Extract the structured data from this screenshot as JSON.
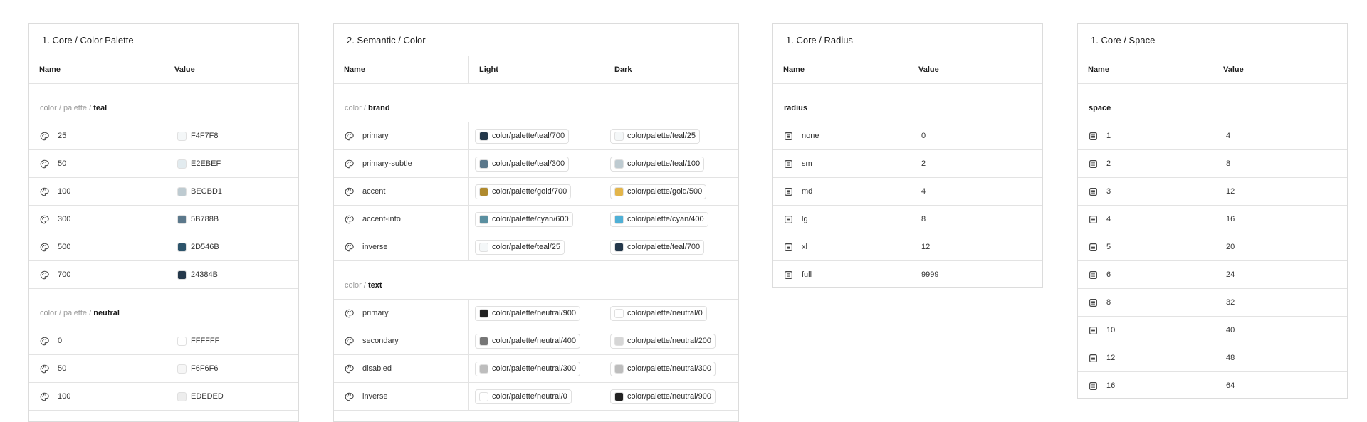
{
  "palette_panel": {
    "title": "1. Core / Color Palette",
    "headers": [
      "Name",
      "Value"
    ],
    "groups": [
      {
        "prefix": "color / palette / ",
        "name": "teal",
        "rows": [
          {
            "name": "25",
            "value": "F4F7F8",
            "color": "#F4F7F8"
          },
          {
            "name": "50",
            "value": "E2EBEF",
            "color": "#E2EBEF"
          },
          {
            "name": "100",
            "value": "BECBD1",
            "color": "#BECBD1"
          },
          {
            "name": "300",
            "value": "5B788B",
            "color": "#5B788B"
          },
          {
            "name": "500",
            "value": "2D546B",
            "color": "#2D546B"
          },
          {
            "name": "700",
            "value": "24384B",
            "color": "#24384B"
          }
        ]
      },
      {
        "prefix": "color / palette / ",
        "name": "neutral",
        "rows": [
          {
            "name": "0",
            "value": "FFFFFF",
            "color": "#FFFFFF"
          },
          {
            "name": "50",
            "value": "F6F6F6",
            "color": "#F6F6F6"
          },
          {
            "name": "100",
            "value": "EDEDED",
            "color": "#EDEDED"
          }
        ]
      }
    ]
  },
  "semantic_panel": {
    "title": "2. Semantic / Color",
    "headers": [
      "Name",
      "Light",
      "Dark"
    ],
    "groups": [
      {
        "prefix": "color / ",
        "name": "brand",
        "rows": [
          {
            "name": "primary",
            "light": "color/palette/teal/700",
            "light_color": "#24384B",
            "dark": "color/palette/teal/25",
            "dark_color": "#F4F7F8"
          },
          {
            "name": "primary-subtle",
            "light": "color/palette/teal/300",
            "light_color": "#5B788B",
            "dark": "color/palette/teal/100",
            "dark_color": "#BECBD1"
          },
          {
            "name": "accent",
            "light": "color/palette/gold/700",
            "light_color": "#B08A2E",
            "dark": "color/palette/gold/500",
            "dark_color": "#E3B54A"
          },
          {
            "name": "accent-info",
            "light": "color/palette/cyan/600",
            "light_color": "#5A8FA0",
            "dark": "color/palette/cyan/400",
            "dark_color": "#4FB0D6"
          },
          {
            "name": "inverse",
            "light": "color/palette/teal/25",
            "light_color": "#F4F7F8",
            "dark": "color/palette/teal/700",
            "dark_color": "#24384B"
          }
        ]
      },
      {
        "prefix": "color / ",
        "name": "text",
        "rows": [
          {
            "name": "primary",
            "light": "color/palette/neutral/900",
            "light_color": "#222222",
            "dark": "color/palette/neutral/0",
            "dark_color": "#FFFFFF"
          },
          {
            "name": "secondary",
            "light": "color/palette/neutral/400",
            "light_color": "#767676",
            "dark": "color/palette/neutral/200",
            "dark_color": "#D6D6D6"
          },
          {
            "name": "disabled",
            "light": "color/palette/neutral/300",
            "light_color": "#BDBDBD",
            "dark": "color/palette/neutral/300",
            "dark_color": "#BDBDBD"
          },
          {
            "name": "inverse",
            "light": "color/palette/neutral/0",
            "light_color": "#FFFFFF",
            "dark": "color/palette/neutral/900",
            "dark_color": "#222222"
          }
        ]
      }
    ]
  },
  "radius_panel": {
    "title": "1. Core / Radius",
    "headers": [
      "Name",
      "Value"
    ],
    "group": "radius",
    "rows": [
      {
        "name": "none",
        "value": "0"
      },
      {
        "name": "sm",
        "value": "2"
      },
      {
        "name": "md",
        "value": "4"
      },
      {
        "name": "lg",
        "value": "8"
      },
      {
        "name": "xl",
        "value": "12"
      },
      {
        "name": "full",
        "value": "9999"
      }
    ]
  },
  "space_panel": {
    "title": "1. Core / Space",
    "headers": [
      "Name",
      "Value"
    ],
    "group": "space",
    "rows": [
      {
        "name": "1",
        "value": "4"
      },
      {
        "name": "2",
        "value": "8"
      },
      {
        "name": "3",
        "value": "12"
      },
      {
        "name": "4",
        "value": "16"
      },
      {
        "name": "5",
        "value": "20"
      },
      {
        "name": "6",
        "value": "24"
      },
      {
        "name": "8",
        "value": "32"
      },
      {
        "name": "10",
        "value": "40"
      },
      {
        "name": "12",
        "value": "48"
      },
      {
        "name": "16",
        "value": "64"
      }
    ]
  },
  "icons": {
    "color_token": "palette-icon",
    "number_token": "number-variable-icon"
  }
}
